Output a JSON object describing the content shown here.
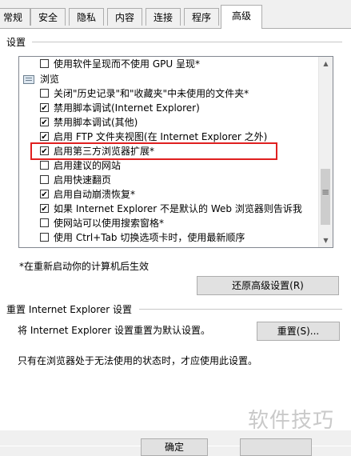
{
  "tabs": [
    {
      "label": "常规"
    },
    {
      "label": "安全"
    },
    {
      "label": "隐私"
    },
    {
      "label": "内容"
    },
    {
      "label": "连接"
    },
    {
      "label": "程序"
    },
    {
      "label": "高级"
    }
  ],
  "settings": {
    "title": "设置",
    "rows": [
      {
        "label": "使用软件呈现而不使用 GPU 呈现*",
        "checked": false
      },
      {
        "label": "浏览",
        "type": "category"
      },
      {
        "label": "关闭\"历史记录\"和\"收藏夹\"中未使用的文件夹*",
        "checked": false
      },
      {
        "label": "禁用脚本调试(Internet Explorer)",
        "checked": true
      },
      {
        "label": "禁用脚本调试(其他)",
        "checked": true
      },
      {
        "label": "启用 FTP 文件夹视图(在 Internet Explorer 之外)",
        "checked": true
      },
      {
        "label": "启用第三方浏览器扩展*",
        "checked": true
      },
      {
        "label": "启用建议的网站",
        "checked": false
      },
      {
        "label": "启用快速翻页",
        "checked": false
      },
      {
        "label": "启用自动崩溃恢复*",
        "checked": true
      },
      {
        "label": "如果 Internet Explorer 不是默认的 Web 浏览器则告诉我",
        "checked": true
      },
      {
        "label": "使网站可以使用搜索窗格*",
        "checked": false
      },
      {
        "label": "使用 Ctrl+Tab 切换选项卡时，使用最新顺序",
        "checked": false
      }
    ],
    "restart_note": "*在重新启动你的计算机后生效",
    "restore_button": "还原高级设置(R)"
  },
  "reset": {
    "title": "重置 Internet Explorer 设置",
    "description": "将 Internet Explorer 设置重置为默认设置。",
    "button": "重置(S)...",
    "note": "只有在浏览器处于无法使用的状态时，才应使用此设置。"
  },
  "footer": {
    "ok_label": "确定"
  },
  "watermark": "软件技巧",
  "colors": {
    "highlight": "#e02020",
    "accent": "#000000"
  }
}
